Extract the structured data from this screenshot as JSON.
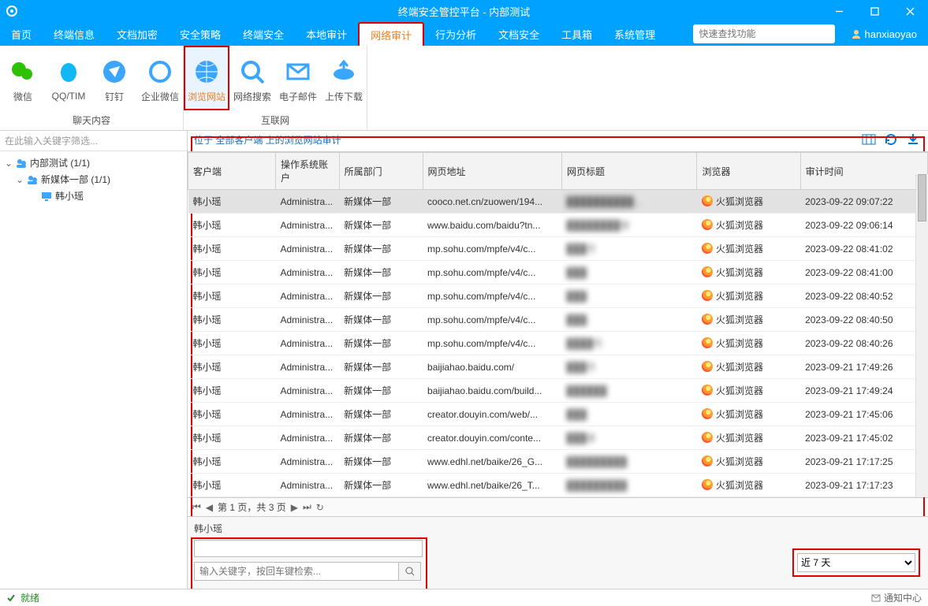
{
  "window": {
    "title": "终端安全管控平台 - 内部测试"
  },
  "menu": {
    "items": [
      "首页",
      "终端信息",
      "文档加密",
      "安全策略",
      "终端安全",
      "本地审计",
      "网络审计",
      "行为分析",
      "文档安全",
      "工具箱",
      "系统管理"
    ],
    "active_index": 6,
    "search_placeholder": "快速查找功能",
    "user": "hanxiaoyao"
  },
  "ribbon": {
    "groups": [
      {
        "label": "聊天内容",
        "buttons": [
          {
            "name": "wechat",
            "label": "微信"
          },
          {
            "name": "qq",
            "label": "QQ/TIM"
          },
          {
            "name": "dingtalk",
            "label": "钉钉"
          },
          {
            "name": "wecom",
            "label": "企业微信"
          }
        ]
      },
      {
        "label": "互联网",
        "buttons": [
          {
            "name": "browse",
            "label": "浏览网站",
            "active": true
          },
          {
            "name": "websearch",
            "label": "网络搜索"
          },
          {
            "name": "email",
            "label": "电子邮件"
          },
          {
            "name": "upload",
            "label": "上传下载"
          }
        ]
      }
    ]
  },
  "sidebar": {
    "filter_placeholder": "在此输入关键字筛选...",
    "tree": [
      {
        "level": 0,
        "expand": "v",
        "icon": "group",
        "label": "内部测试 (1/1)"
      },
      {
        "level": 1,
        "expand": "v",
        "icon": "group",
        "label": "新媒体一部 (1/1)"
      },
      {
        "level": 2,
        "expand": "",
        "icon": "pc",
        "label": "韩小瑶",
        "selected": false
      }
    ]
  },
  "crumb": "位于 全部客户端 上的浏览网站审计",
  "columns": [
    "客户端",
    "操作系统账户",
    "所属部门",
    "网页地址",
    "网页标题",
    "浏览器",
    "审计时间"
  ],
  "rows": [
    {
      "sel": true,
      "c": [
        "韩小瑶",
        "Administra...",
        "新媒体一部",
        "cooco.net.cn/zuowen/194...",
        "██████████...",
        "火狐浏览器",
        "2023-09-22 09:07:22"
      ]
    },
    {
      "c": [
        "韩小瑶",
        "Administra...",
        "新媒体一部",
        "www.baidu.com/baidu?tn...",
        "████████搜",
        "火狐浏览器",
        "2023-09-22 09:06:14"
      ]
    },
    {
      "c": [
        "韩小瑶",
        "Administra...",
        "新媒体一部",
        "mp.sohu.com/mpfe/v4/c...",
        "███号",
        "火狐浏览器",
        "2023-09-22 08:41:02"
      ]
    },
    {
      "c": [
        "韩小瑶",
        "Administra...",
        "新媒体一部",
        "mp.sohu.com/mpfe/v4/c...",
        "███",
        "火狐浏览器",
        "2023-09-22 08:41:00"
      ]
    },
    {
      "c": [
        "韩小瑶",
        "Administra...",
        "新媒体一部",
        "mp.sohu.com/mpfe/v4/c...",
        "███",
        "火狐浏览器",
        "2023-09-22 08:40:52"
      ]
    },
    {
      "c": [
        "韩小瑶",
        "Administra...",
        "新媒体一部",
        "mp.sohu.com/mpfe/v4/c...",
        "███",
        "火狐浏览器",
        "2023-09-22 08:40:50"
      ]
    },
    {
      "c": [
        "韩小瑶",
        "Administra...",
        "新媒体一部",
        "mp.sohu.com/mpfe/v4/c...",
        "████号",
        "火狐浏览器",
        "2023-09-22 08:40:26"
      ]
    },
    {
      "c": [
        "韩小瑶",
        "Administra...",
        "新媒体一部",
        "baijiahao.baidu.com/",
        "███号",
        "火狐浏览器",
        "2023-09-21 17:49:26"
      ]
    },
    {
      "c": [
        "韩小瑶",
        "Administra...",
        "新媒体一部",
        "baijiahao.baidu.com/build...",
        "██████",
        "火狐浏览器",
        "2023-09-21 17:49:24"
      ]
    },
    {
      "c": [
        "韩小瑶",
        "Administra...",
        "新媒体一部",
        "creator.douyin.com/web/...",
        "███",
        "火狐浏览器",
        "2023-09-21 17:45:06"
      ]
    },
    {
      "c": [
        "韩小瑶",
        "Administra...",
        "新媒体一部",
        "creator.douyin.com/conte...",
        "███者",
        "火狐浏览器",
        "2023-09-21 17:45:02"
      ]
    },
    {
      "c": [
        "韩小瑶",
        "Administra...",
        "新媒体一部",
        "www.edhl.net/baike/26_G...",
        "█████████",
        "火狐浏览器",
        "2023-09-21 17:17:25"
      ]
    },
    {
      "c": [
        "韩小瑶",
        "Administra...",
        "新媒体一部",
        "www.edhl.net/baike/26_T...",
        "█████████",
        "火狐浏览器",
        "2023-09-21 17:17:23"
      ]
    }
  ],
  "pager": "第 1 页，共 3 页",
  "detail": {
    "name": "韩小瑶",
    "search_placeholder": "输入关键字，按回车键检索...",
    "range": "近 7 天"
  },
  "status": {
    "text": "就绪",
    "right": "通知中心"
  }
}
